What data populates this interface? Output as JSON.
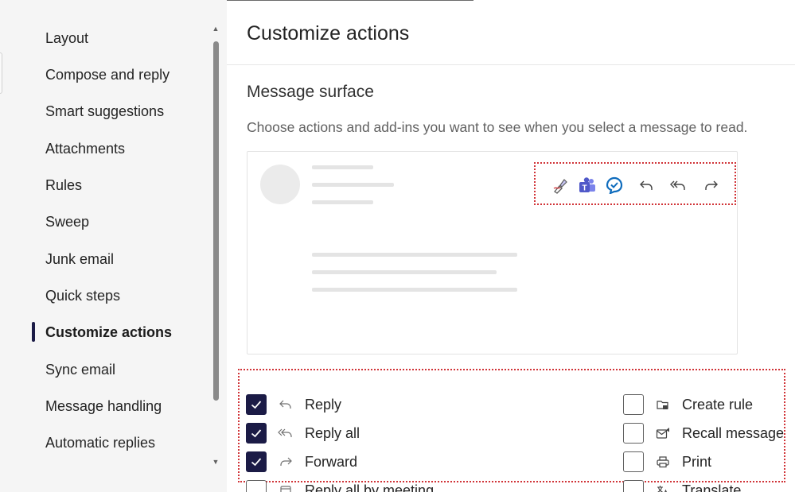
{
  "nav": {
    "items": [
      {
        "label": "Layout"
      },
      {
        "label": "Compose and reply"
      },
      {
        "label": "Smart suggestions"
      },
      {
        "label": "Attachments"
      },
      {
        "label": "Rules"
      },
      {
        "label": "Sweep"
      },
      {
        "label": "Junk email"
      },
      {
        "label": "Quick steps"
      },
      {
        "label": "Customize actions",
        "active": true
      },
      {
        "label": "Sync email"
      },
      {
        "label": "Message handling"
      },
      {
        "label": "Automatic replies"
      }
    ]
  },
  "main": {
    "title": "Customize actions",
    "section_title": "Message surface",
    "section_desc": "Choose actions and add-ins you want to see when you select a message to read.",
    "preview_toolbar_icons": [
      "sign-addin-icon",
      "teams-icon",
      "viva-insights-icon",
      "reply-icon",
      "reply-all-icon",
      "forward-icon"
    ],
    "actions_left": [
      {
        "label": "Reply",
        "checked": true,
        "icon": "reply-icon"
      },
      {
        "label": "Reply all",
        "checked": true,
        "icon": "reply-all-icon"
      },
      {
        "label": "Forward",
        "checked": true,
        "icon": "forward-icon"
      },
      {
        "label": "Reply all by meeting",
        "checked": false,
        "icon": "calendar-reply-icon"
      }
    ],
    "actions_right": [
      {
        "label": "Create rule",
        "checked": false,
        "icon": "create-rule-icon"
      },
      {
        "label": "Recall message",
        "checked": false,
        "icon": "recall-message-icon"
      },
      {
        "label": "Print",
        "checked": false,
        "icon": "print-icon"
      },
      {
        "label": "Translate",
        "checked": false,
        "icon": "translate-icon"
      }
    ]
  },
  "colors": {
    "accent": "#1b1b46",
    "highlight_border": "#d13438",
    "nav_background": "#f5f5f5",
    "teams": "#5059c9",
    "viva": "#0f6cbd"
  }
}
